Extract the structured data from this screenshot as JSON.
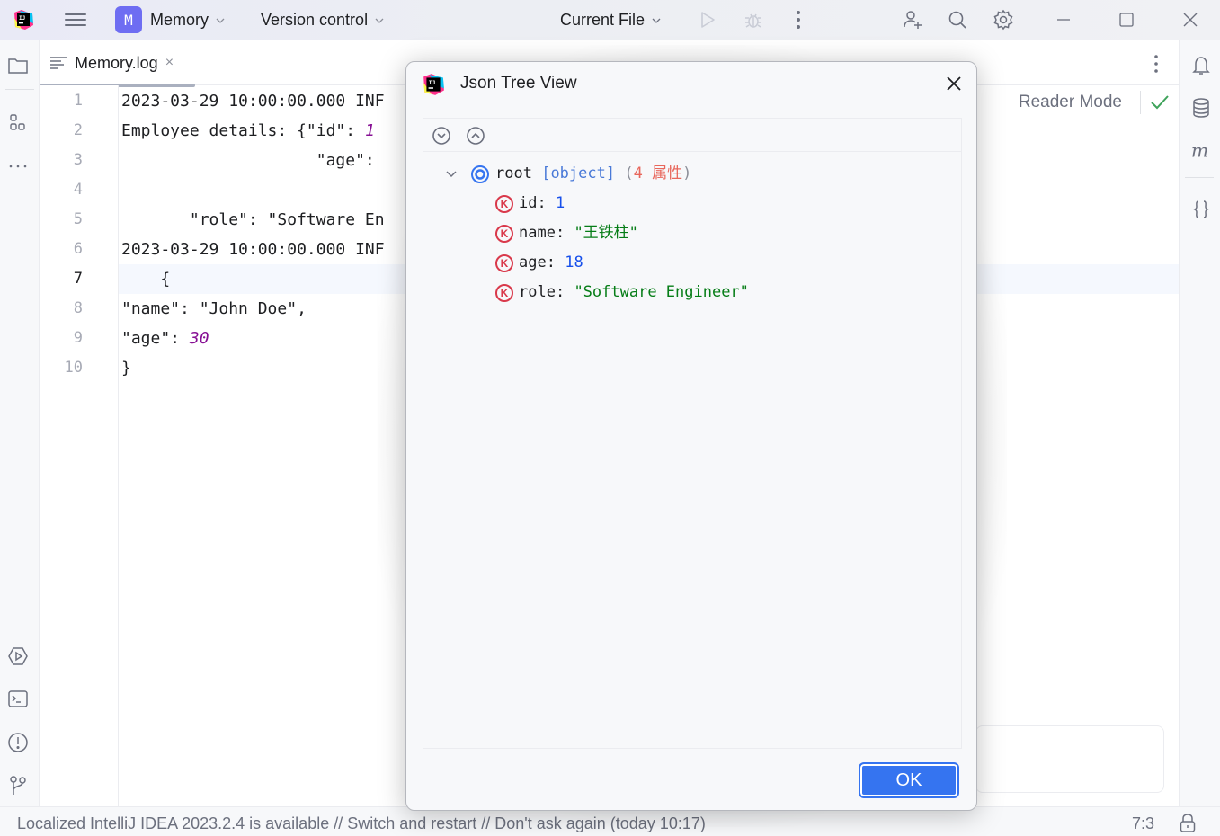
{
  "titlebar": {
    "project_badge": "M",
    "project_name": "Memory",
    "vcs_label": "Version control",
    "run_config": "Current File",
    "icons": [
      "app-logo-icon",
      "hamburger-menu-icon",
      "run-icon",
      "debug-icon",
      "more-vertical-icon",
      "add-user-icon",
      "search-icon",
      "settings-gear-icon",
      "minimize-icon",
      "maximize-icon",
      "close-icon"
    ]
  },
  "left_strip": {
    "icons": [
      "project-folder-icon",
      "structure-icon",
      "more-horizontal-icon",
      "services-icon",
      "terminal-icon",
      "problems-icon",
      "git-branch-icon"
    ]
  },
  "right_strip": {
    "icons": [
      "notifications-bell-icon",
      "database-icon",
      "maven-icon",
      "json-braces-icon"
    ]
  },
  "editor": {
    "tab": {
      "filename": "Memory.log",
      "close": "×"
    },
    "reader_mode": "Reader Mode",
    "current_line": 7,
    "lines": [
      {
        "n": "1",
        "text": "2023-03-29 10:00:00.000 INF",
        "num": ""
      },
      {
        "n": "2",
        "text": "Employee details: {\"id\": ",
        "num": "1"
      },
      {
        "n": "3",
        "text": "                    \"age\":",
        "num": ""
      },
      {
        "n": "4",
        "text": "",
        "num": ""
      },
      {
        "n": "5",
        "text": "       \"role\": \"Software En",
        "num": ""
      },
      {
        "n": "6",
        "text": "2023-03-29 10:00:00.000 INF",
        "num": ""
      },
      {
        "n": "7",
        "text": "    {",
        "num": ""
      },
      {
        "n": "8",
        "text": "\"name\": \"John Doe\",",
        "num": ""
      },
      {
        "n": "9",
        "text": "\"age\": ",
        "num": "30"
      },
      {
        "n": "10",
        "text": "}",
        "num": ""
      }
    ]
  },
  "dialog": {
    "title": "Json Tree View",
    "toolbar": {
      "expand_all": "expand-all-icon",
      "collapse_all": "collapse-all-icon"
    },
    "root": {
      "label": "root",
      "type": "[object]",
      "open_paren": "(",
      "count": "4",
      "count_label": "属性",
      "close_paren": ")"
    },
    "properties": [
      {
        "key": "id",
        "value": "1",
        "kind": "number"
      },
      {
        "key": "name",
        "value": "\"王铁柱\"",
        "kind": "string"
      },
      {
        "key": "age",
        "value": "18",
        "kind": "number"
      },
      {
        "key": "role",
        "value": "\"Software Engineer\"",
        "kind": "string"
      }
    ],
    "ok_label": "OK",
    "badge_letter": "K"
  },
  "statusbar": {
    "message": "Localized IntelliJ IDEA 2023.2.4 is available // Switch and restart // Don't ask again (today 10:17)",
    "position": "7:3"
  },
  "colors": {
    "accent": "#3574f0",
    "project_badge": "#6e6df2",
    "number_italic": "#871094",
    "tree_number": "#1750eb",
    "tree_string": "#067d17",
    "key_badge": "#d9394b",
    "check_green": "#3ea35a"
  }
}
